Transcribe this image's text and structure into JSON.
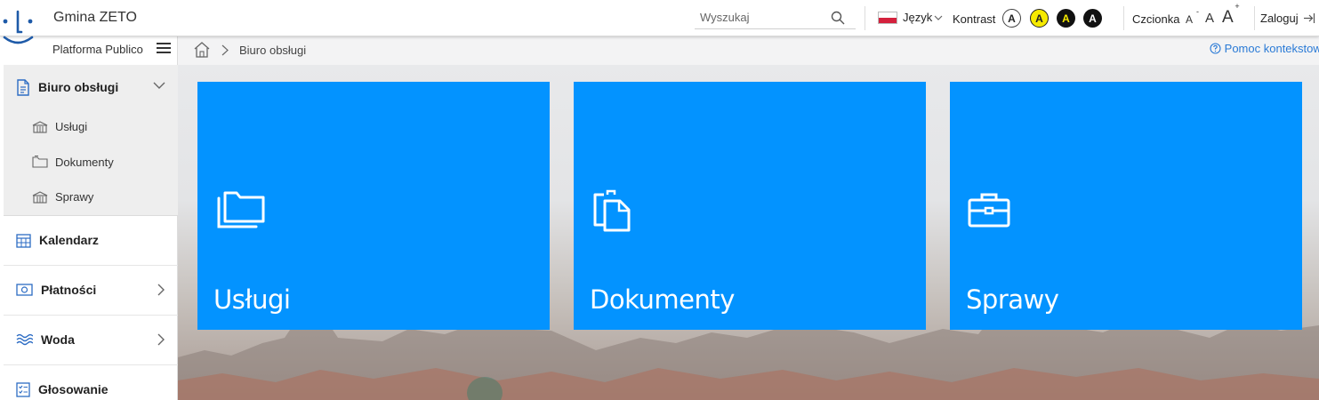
{
  "header": {
    "app_title": "Gmina ZETO",
    "search_placeholder": "Wyszukaj",
    "language_label": "Język",
    "contrast_label": "Kontrast",
    "contrast_options": [
      "A",
      "A",
      "A",
      "A"
    ],
    "font_label": "Czcionka",
    "font_options": [
      "A",
      "A",
      "A"
    ],
    "font_decrease_mark": "-",
    "font_increase_mark": "+",
    "login_label": "Zaloguj"
  },
  "sidebar": {
    "platform_label": "Platforma Publico",
    "items": [
      {
        "label": "Biuro obsługi",
        "icon": "document-icon",
        "expanded": true
      },
      {
        "label": "Kalendarz",
        "icon": "calendar-icon"
      },
      {
        "label": "Płatności",
        "icon": "payment-icon"
      },
      {
        "label": "Woda",
        "icon": "water-icon"
      },
      {
        "label": "Głosowanie",
        "icon": "voting-icon"
      }
    ],
    "sub_items": [
      {
        "label": "Usługi",
        "icon": "building-icon"
      },
      {
        "label": "Dokumenty",
        "icon": "folder-icon"
      },
      {
        "label": "Sprawy",
        "icon": "building-icon"
      }
    ]
  },
  "breadcrumb": {
    "current": "Biuro obsługi"
  },
  "help_label": "Pomoc kontekstowa",
  "tiles": [
    {
      "label": "Usługi",
      "icon": "folders-icon"
    },
    {
      "label": "Dokumenty",
      "icon": "documents-icon"
    },
    {
      "label": "Sprawy",
      "icon": "briefcase-icon"
    }
  ],
  "colors": {
    "tile_blue": "#0393ff",
    "logo_blue": "#1e5aa8",
    "contrast_yellow": "#f6ea00",
    "link_blue": "#2a7ad6"
  }
}
